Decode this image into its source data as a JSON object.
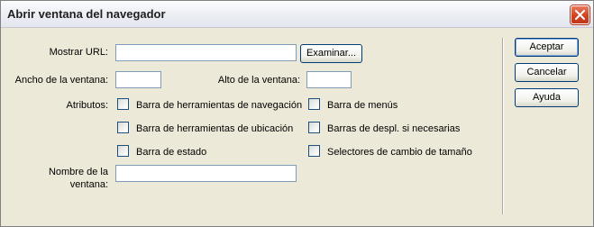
{
  "window": {
    "title": "Abrir ventana del navegador"
  },
  "form": {
    "url_label": "Mostrar URL:",
    "url_value": "",
    "browse_label": "Examinar...",
    "width_label": "Ancho de la ventana:",
    "width_value": "",
    "height_label": "Alto de la ventana:",
    "height_value": "",
    "attributes_label": "Atributos:",
    "attributes": [
      {
        "label": "Barra de herramientas de navegación",
        "checked": false
      },
      {
        "label": "Barra de menús",
        "checked": false
      },
      {
        "label": "Barra de herramientas de ubicación",
        "checked": false
      },
      {
        "label": "Barras de despl. si necesarias",
        "checked": false
      },
      {
        "label": "Barra de estado",
        "checked": false
      },
      {
        "label": "Selectores de cambio de tamaño",
        "checked": false
      }
    ],
    "name_label_line1": "Nombre de la",
    "name_label_line2": "ventana:",
    "name_value": ""
  },
  "buttons": {
    "ok": "Aceptar",
    "cancel": "Cancelar",
    "help": "Ayuda"
  }
}
